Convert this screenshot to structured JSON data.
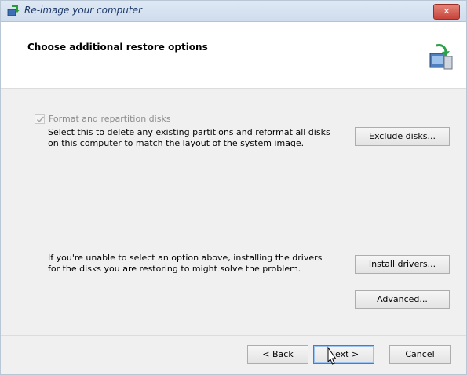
{
  "window": {
    "title": "Re-image your computer",
    "close_label": "✕"
  },
  "header": {
    "title": "Choose additional restore options"
  },
  "format_option": {
    "label": "Format and repartition disks",
    "checked": true,
    "enabled": false,
    "description_line1": "Select this to delete any existing partitions and reformat all disks",
    "description_line2": "on this computer to match the layout of the system image."
  },
  "drivers_info": {
    "line1": "If you're unable to select an option above, installing the drivers",
    "line2": "for the disks you are restoring to might solve the problem."
  },
  "buttons": {
    "exclude_disks": "Exclude disks...",
    "install_drivers": "Install drivers...",
    "advanced": "Advanced...",
    "back": "< Back",
    "next": "Next >",
    "cancel": "Cancel"
  },
  "icons": {
    "title": "restore-icon",
    "header": "system-image-restore-icon",
    "cursor": "mouse-pointer-icon"
  },
  "colors": {
    "title_text": "#1e3a6a",
    "close_button": "#c7433a",
    "default_button_border": "#3c7fd6"
  }
}
